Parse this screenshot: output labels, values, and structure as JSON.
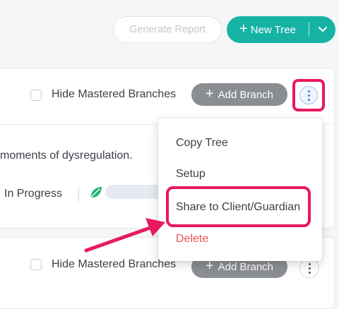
{
  "header": {
    "generate_report": "Generate Report",
    "new_tree": "New Tree"
  },
  "card1": {
    "hide_mastered": "Hide Mastered Branches",
    "add_branch": "Add Branch",
    "description": "moments of dysregulation.",
    "status": "In Progress"
  },
  "menu": {
    "items": [
      "Copy Tree",
      "Setup",
      "Share to Client/Guardian",
      "Delete"
    ]
  },
  "card2": {
    "hide_mastered": "Hide Mastered Branches",
    "add_branch": "Add Branch"
  },
  "colors": {
    "accent": "#16b3a5",
    "highlight": "#e8195e",
    "danger": "#f05252",
    "leaf": "#22b573"
  }
}
